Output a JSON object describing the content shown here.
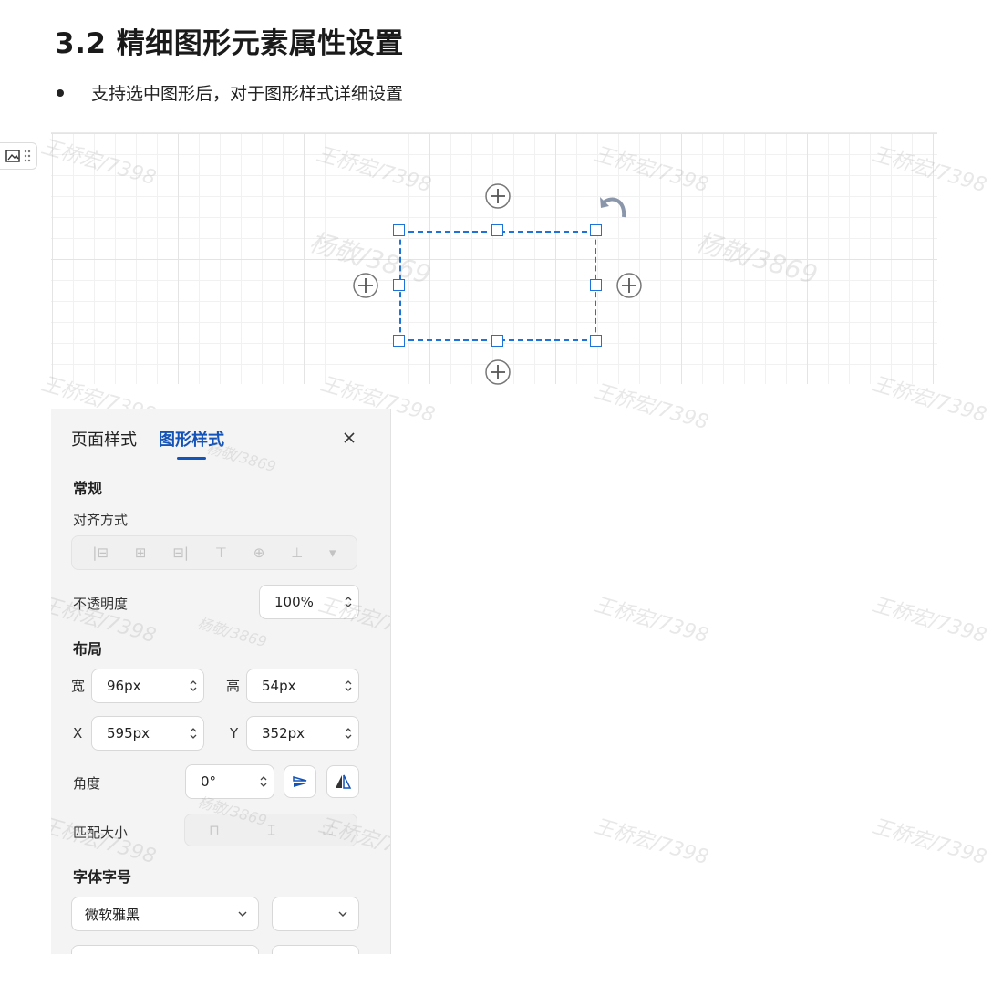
{
  "doc": {
    "heading": "3.2 精细图形元素属性设置",
    "bullet": "支持选中图形后，对于图形样式详细设置"
  },
  "watermarks": [
    "王桥宏/7398",
    "杨敬/3869"
  ],
  "panel": {
    "tabs": [
      {
        "label": "页面样式",
        "active": false
      },
      {
        "label": "图形样式",
        "active": true
      }
    ],
    "close_icon": "close-icon",
    "general": {
      "title": "常规",
      "align_label": "对齐方式",
      "align_icons": [
        "align-left-icon",
        "align-center-h-icon",
        "align-right-icon",
        "align-top-icon",
        "align-middle-v-icon",
        "align-bottom-icon",
        "more-chevron-icon"
      ],
      "opacity_label": "不透明度",
      "opacity_value": "100%"
    },
    "layout": {
      "title": "布局",
      "width_label": "宽",
      "width_value": "96px",
      "height_label": "高",
      "height_value": "54px",
      "x_label": "X",
      "x_value": "595px",
      "y_label": "Y",
      "y_value": "352px",
      "angle_label": "角度",
      "angle_value": "0°",
      "match_label": "匹配大小"
    },
    "font": {
      "title": "字体字号",
      "family_value": "微软雅黑",
      "size_value": ""
    }
  },
  "colors": {
    "accent": "#1453b8",
    "selection": "#1e73d8"
  }
}
